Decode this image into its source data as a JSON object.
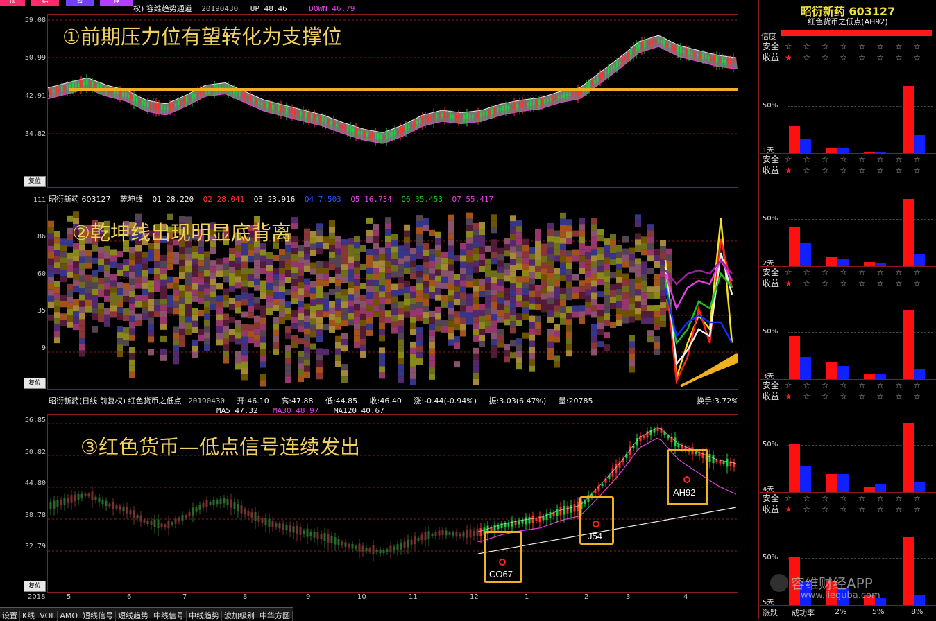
{
  "toolbar_top": {
    "buttons": [
      "顶",
      "幅",
      "云",
      "荐"
    ]
  },
  "panel1": {
    "header_name": "权) 容维趋势通道",
    "header_date": "20190430",
    "up_label": "UP 48.46",
    "down_label": "DOWN 46.79",
    "y_ticks": [
      "59.08",
      "50.99",
      "42.91",
      "34.82"
    ],
    "annotation": "①前期压力位有望转化为支撑位",
    "reset_label": "复位"
  },
  "panel2": {
    "header_name": "昭衍新药 603127",
    "indicator": "乾坤线",
    "q1": "Q1 28.220",
    "q2": "Q2 28.041",
    "q3": "Q3 23.916",
    "q4": "Q4 7.503",
    "q5": "Q5 16.734",
    "q6": "Q6 35.453",
    "q7": "Q7 55.417",
    "y_ticks": [
      "111",
      "86",
      "60",
      "35",
      "9"
    ],
    "annotation": "②乾坤线出现明显底背离",
    "reset_label": "复位"
  },
  "panel3": {
    "header_name": "昭衍新药(日线 前复权) 红色货币之低点",
    "header_date": "20190430",
    "open": "开:46.10",
    "high": "高:47.88",
    "low": "低:44.85",
    "close": "收:46.40",
    "change": "涨:-0.44(-0.94%)",
    "amplitude": "振:3.03(6.47%)",
    "volume": "量:20785",
    "turnover": "换手:3.72%",
    "ma5": "MA5 47.32",
    "ma30": "MA30 48.97",
    "ma120": "MA120 40.67",
    "y_ticks": [
      "56.85",
      "50.82",
      "44.80",
      "38.78",
      "32.79"
    ],
    "annotation": "③红色货币—低点信号连续发出",
    "signals": [
      "CO67",
      "J54",
      "AH92"
    ],
    "reset_label": "复位"
  },
  "x_axis": {
    "year": "2018",
    "months": [
      "5",
      "6",
      "7",
      "8",
      "9",
      "10",
      "11",
      "12",
      "1",
      "2",
      "3",
      "4"
    ]
  },
  "bottom_tabs": [
    "设置",
    "K线",
    "VOL",
    "AMO",
    "短线信号",
    "短线趋势",
    "中线信号",
    "中线趋势",
    "波加级别",
    "中华方圆"
  ],
  "right_panel": {
    "stock_title": "昭衍新药 603127",
    "subtitle": "红色货币之低点(AH92)",
    "confidence_label": "信度",
    "safety_label": "安全",
    "profit_label": "收益",
    "blocks": [
      {
        "pct_label": "50%",
        "day_label": "1天",
        "bars": [
          [
            0.39,
            0.2
          ],
          [
            0.08,
            0.08
          ],
          [
            0.02,
            0.02
          ],
          [
            0.97,
            0.26
          ]
        ]
      },
      {
        "pct_label": "50%",
        "day_label": "2天",
        "bars": [
          [
            0.56,
            0.33
          ],
          [
            0.13,
            0.11
          ],
          [
            0.06,
            0.05
          ],
          [
            0.97,
            0.18
          ]
        ]
      },
      {
        "pct_label": "50%",
        "day_label": "3天",
        "bars": [
          [
            0.62,
            0.32
          ],
          [
            0.24,
            0.19
          ],
          [
            0.07,
            0.07
          ],
          [
            1.0,
            0.14
          ]
        ]
      },
      {
        "pct_label": "50%",
        "day_label": "4天",
        "bars": [
          [
            0.7,
            0.37
          ],
          [
            0.26,
            0.26
          ],
          [
            0.08,
            0.12
          ],
          [
            1.0,
            0.15
          ]
        ]
      },
      {
        "pct_label": "50%",
        "day_label": "5天",
        "bars": [
          [
            0.7,
            0.35
          ],
          [
            0.35,
            0.25
          ],
          [
            0.15,
            0.1
          ],
          [
            0.98,
            0.15
          ]
        ]
      }
    ],
    "footer": [
      "涨跌",
      "成功率",
      "2%",
      "5%",
      "8%"
    ]
  },
  "watermark": {
    "brand": "容维财经APP",
    "url": "www.lieguba.com"
  },
  "colors": {
    "up": "#ff3030",
    "down": "#00c8c8",
    "accent": "#f0b020",
    "ma5": "#f0f0f0",
    "ma30": "#e040e0",
    "ma120": "#f0f0f0"
  }
}
